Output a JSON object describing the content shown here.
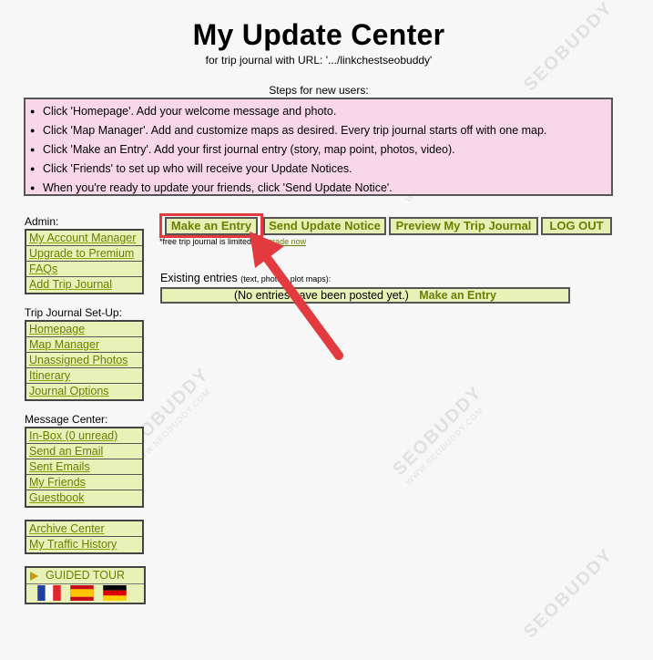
{
  "header": {
    "title": "My Update Center",
    "subtitle": "for trip journal with URL: '.../linkchestseobuddy'"
  },
  "steps": {
    "heading": "Steps for new users:",
    "items": [
      "Click 'Homepage'. Add your welcome message and photo.",
      "Click 'Map Manager'. Add and customize maps as desired. Every trip journal starts off with one map.",
      "Click 'Make an Entry'. Add your first journal entry (story, map point, photos, video).",
      "Click 'Friends' to set up who will receive your Update Notices.",
      "When you're ready to update your friends, click 'Send Update Notice'."
    ]
  },
  "sidebar": {
    "admin": {
      "label": "Admin:",
      "items": [
        "My Account Manager",
        "Upgrade to Premium",
        "FAQs",
        "Add Trip Journal"
      ]
    },
    "setup": {
      "label": "Trip Journal Set-Up:",
      "items": [
        "Homepage",
        "Map Manager",
        "Unassigned Photos",
        "Itinerary",
        "Journal Options"
      ]
    },
    "messages": {
      "label": "Message Center:",
      "items": [
        "In-Box (0 unread)",
        "Send an Email",
        "Sent Emails",
        "My Friends",
        "Guestbook"
      ]
    },
    "archive": {
      "items": [
        "Archive Center",
        "My Traffic History"
      ]
    },
    "tour": {
      "label": "GUIDED TOUR",
      "flags": [
        "flag-france-icon",
        "flag-spain-icon",
        "flag-germany-icon"
      ]
    }
  },
  "toolbar": {
    "make_entry": "Make an Entry",
    "send_notice": "Send Update Notice",
    "preview": "Preview My Trip Journal",
    "logout": "LOG OUT"
  },
  "notice": {
    "text": "*free trip journal is limited -",
    "link": "upgrade now"
  },
  "entries": {
    "label": "Existing entries",
    "label_note": "(text, photos, plot maps):",
    "empty_text": "(No entries have been posted yet.)",
    "action": "Make an Entry"
  },
  "watermark": {
    "brand": "SEOBUDDY",
    "domain": "WWW.SEOBUDDY.COM"
  },
  "colors": {
    "link_green": "#6b7f00",
    "button_bg": "#e6efb4",
    "steps_bg": "#f8d8e8",
    "highlight_red": "#e23a3f"
  }
}
